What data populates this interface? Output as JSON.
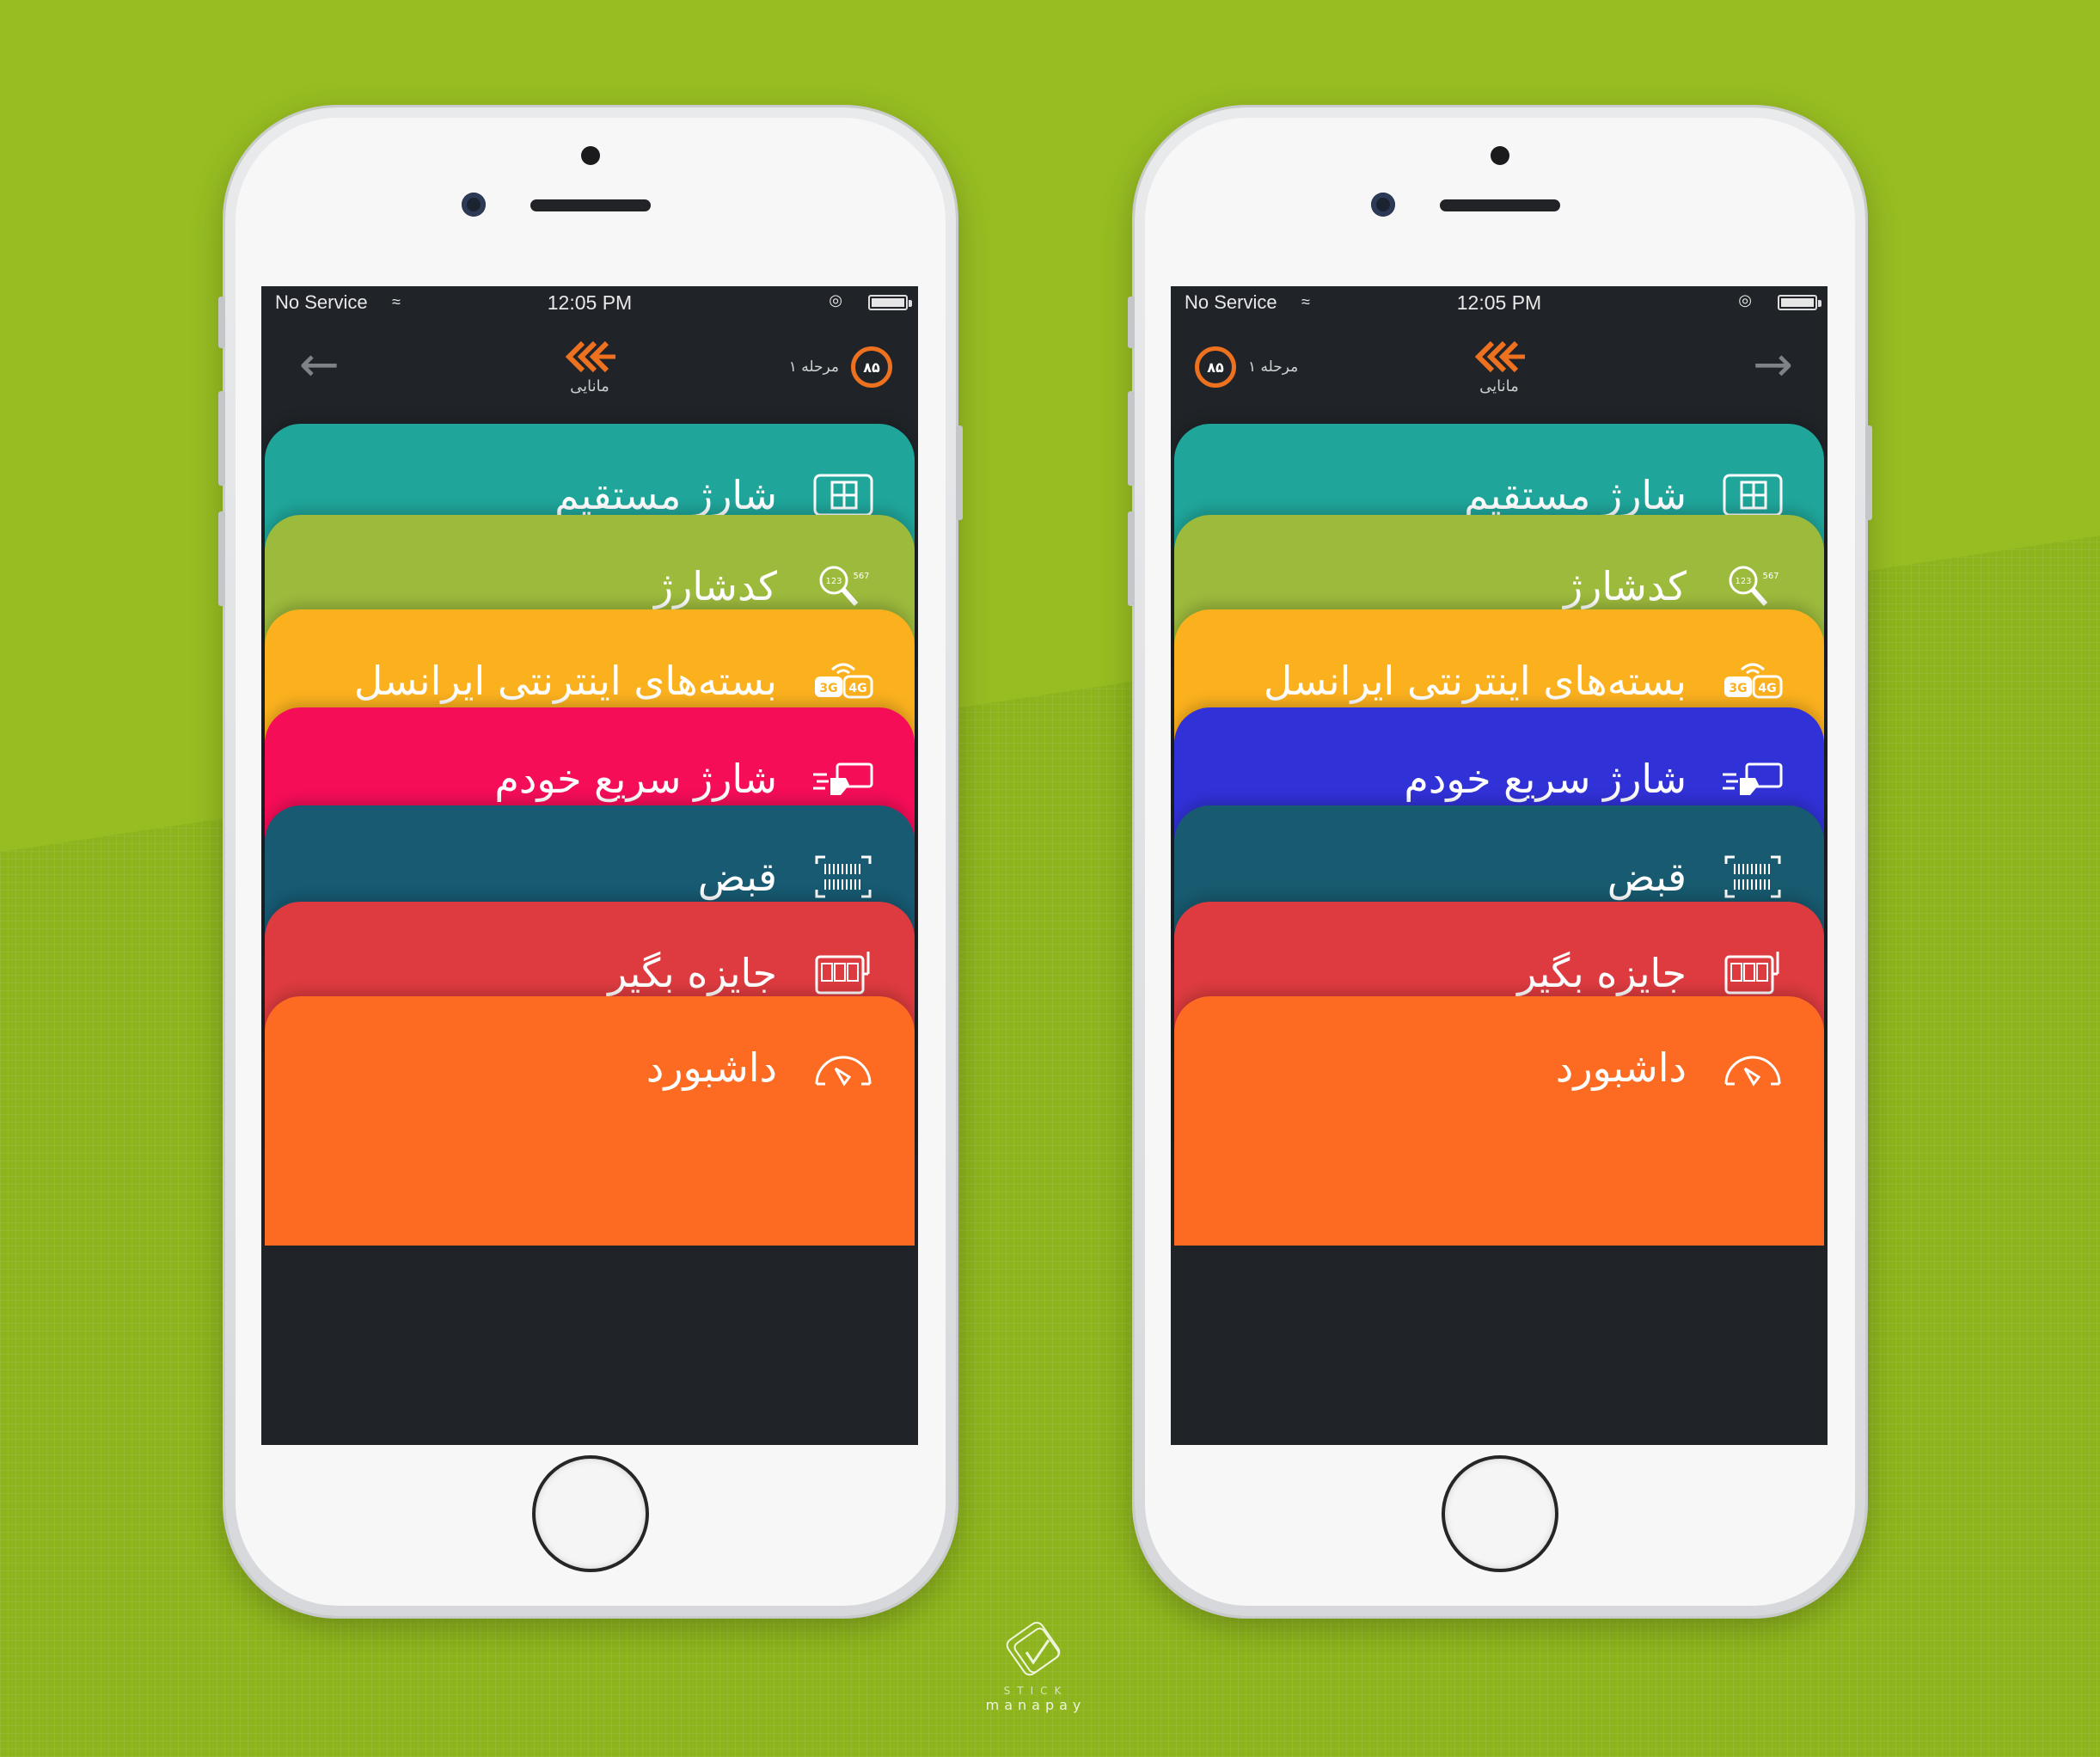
{
  "colors": {
    "background_top": "#97bd22",
    "background_bottom": "#8db41c",
    "accent_orange": "#ee7120",
    "appbar_dark": "#202428"
  },
  "phones": [
    {
      "status": {
        "service": "No Service",
        "time": "12:05 PM"
      },
      "header": {
        "logo_text": "مانایی",
        "level_label": "مرحله ۱",
        "level_value": "۸۵",
        "arrow_icon": "arrow-left-icon"
      },
      "cards": [
        {
          "label": "شارژ مستقیم",
          "icon": "sim-card-icon",
          "color": "#1fa59a"
        },
        {
          "label": "کدشارژ",
          "icon": "charge-code-search-icon",
          "color": "#9cba3c"
        },
        {
          "label": "بسته‌های اینترنتی ایرانسل",
          "icon": "3g-4g-icon",
          "color": "#fbb11e"
        },
        {
          "label": "شارژ سریع خودم",
          "icon": "fast-card-icon",
          "color": "#f50d58"
        },
        {
          "label": "قبض",
          "icon": "barcode-icon",
          "color": "#175a72"
        },
        {
          "label": "جایزه بگیر",
          "icon": "slot-machine-icon",
          "color": "#dd3b3f"
        },
        {
          "label": "داشبورد",
          "icon": "gauge-icon",
          "color": "#fd6a22"
        }
      ]
    },
    {
      "status": {
        "service": "No Service",
        "time": "12:05 PM"
      },
      "header": {
        "logo_text": "مانایی",
        "level_label": "مرحله ۱",
        "level_value": "۸۵",
        "arrow_icon": "arrow-right-icon"
      },
      "cards": [
        {
          "label": "شارژ مستقیم",
          "icon": "sim-card-icon",
          "color": "#1fa59a"
        },
        {
          "label": "کدشارژ",
          "icon": "charge-code-search-icon",
          "color": "#9cba3c"
        },
        {
          "label": "بسته‌های اینترنتی ایرانسل",
          "icon": "3g-4g-icon",
          "color": "#fbb11e"
        },
        {
          "label": "شارژ سریع خودم",
          "icon": "fast-card-icon",
          "color": "#3131d8"
        },
        {
          "label": "قبض",
          "icon": "barcode-icon",
          "color": "#185a6f"
        },
        {
          "label": "جایزه بگیر",
          "icon": "slot-machine-icon",
          "color": "#dd3b3f"
        },
        {
          "label": "داشبورد",
          "icon": "gauge-icon",
          "color": "#fd6a22"
        }
      ]
    }
  ],
  "watermark": {
    "sub": "STICK",
    "name": "manapay"
  }
}
